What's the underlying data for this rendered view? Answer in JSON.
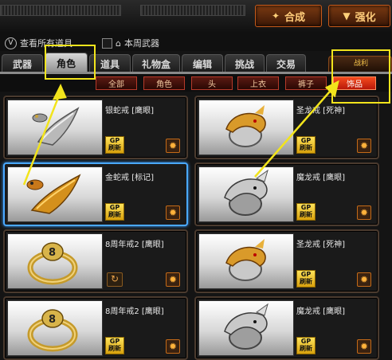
{
  "toolbar": {
    "synthesize_label": "合成",
    "enhance_label": "强化"
  },
  "filters": {
    "show_all_label": "查看所有道具",
    "weekly_weapons_label": "本周武器"
  },
  "tabs": [
    "武器",
    "角色",
    "道具",
    "礼物盒",
    "编辑",
    "挑战",
    "交易"
  ],
  "active_tab": "角色",
  "side_label": "战利",
  "subcategories": [
    "全部",
    "角色",
    "头",
    "上衣",
    "裤子",
    "饰品"
  ],
  "active_subcategory": "饰品",
  "items": [
    {
      "name": "银蛇戒 [鹰眼]",
      "price_tag": [
        "GP",
        "刷新"
      ],
      "icon": "silver-snake-ring-icon",
      "selected": false,
      "style": "silver-snake"
    },
    {
      "name": "圣龙戒 [死神]",
      "price_tag": [
        "GP",
        "刷新"
      ],
      "icon": "holy-dragon-ring-icon",
      "selected": false,
      "style": "gold-dragon"
    },
    {
      "name": "金蛇戒 [标记]",
      "price_tag": [
        "GP",
        "刷新"
      ],
      "icon": "gold-snake-ring-icon",
      "selected": true,
      "style": "gold-snake"
    },
    {
      "name": "魔龙戒 [鹰眼]",
      "price_tag": [
        "GP",
        "刷新"
      ],
      "icon": "demon-dragon-ring-icon",
      "selected": false,
      "style": "silver-dragon"
    },
    {
      "name": "8周年戒2 [鹰眼]",
      "price_tag": [],
      "icon": "anniversary-ring-icon",
      "selected": false,
      "style": "ring8"
    },
    {
      "name": "圣龙戒 [死神]",
      "price_tag": [
        "GP",
        "刷新"
      ],
      "icon": "holy-dragon-ring-icon",
      "selected": false,
      "style": "gold-dragon"
    },
    {
      "name": "8周年戒2 [鹰眼]",
      "price_tag": [
        "GP",
        "刷新"
      ],
      "icon": "anniversary-ring-icon",
      "selected": false,
      "style": "ring8"
    },
    {
      "name": "魔龙戒 [鹰眼]",
      "price_tag": [
        "GP",
        "刷新"
      ],
      "icon": "demon-dragon-ring-icon",
      "selected": false,
      "style": "silver-dragon"
    }
  ],
  "colors": {
    "highlight_annotation": "#f2e41c",
    "active_subcategory": "#e8381a",
    "selected_card": "#4aa8ff"
  }
}
